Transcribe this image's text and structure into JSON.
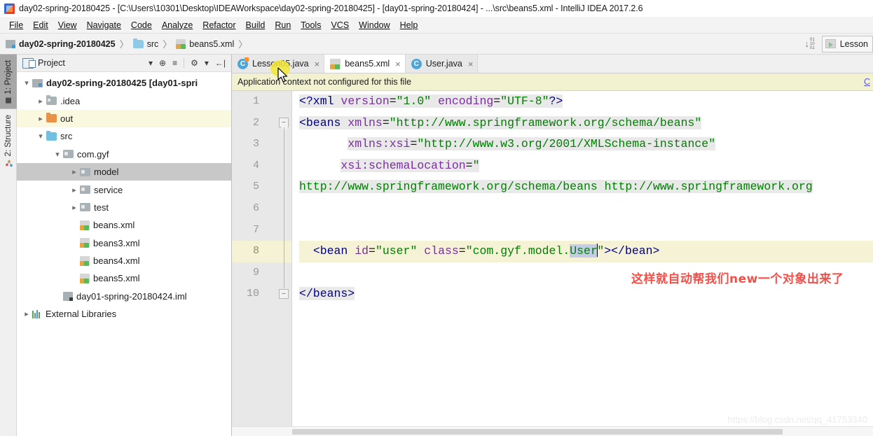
{
  "window": {
    "title": "day02-spring-20180425 - [C:\\Users\\10301\\Desktop\\IDEAWorkspace\\day02-spring-20180425] - [day01-spring-20180424] - ...\\src\\beans5.xml - IntelliJ IDEA 2017.2.6",
    "app_icon": "intellij-idea-icon"
  },
  "menubar": {
    "items": [
      {
        "label": "File"
      },
      {
        "label": "Edit"
      },
      {
        "label": "View"
      },
      {
        "label": "Navigate"
      },
      {
        "label": "Code"
      },
      {
        "label": "Analyze"
      },
      {
        "label": "Refactor"
      },
      {
        "label": "Build"
      },
      {
        "label": "Run"
      },
      {
        "label": "Tools"
      },
      {
        "label": "VCS"
      },
      {
        "label": "Window"
      },
      {
        "label": "Help"
      }
    ]
  },
  "navbar": {
    "crumbs": [
      {
        "label": "day02-spring-20180425",
        "icon": "module-icon",
        "bold": true
      },
      {
        "label": "src",
        "icon": "source-folder-icon",
        "bold": false
      },
      {
        "label": "beans5.xml",
        "icon": "xml-file-icon",
        "bold": false
      }
    ],
    "separator": "〉",
    "sort_icon": "sort-numeric-icon",
    "run_config": {
      "label": "Lesson",
      "icon": "run-config-icon"
    }
  },
  "toolstrip": {
    "tabs": [
      {
        "label": "1: Project",
        "icon": "project-tool-icon",
        "active": true
      },
      {
        "label": "2: Structure",
        "icon": "structure-tool-icon",
        "active": false
      }
    ]
  },
  "project_panel": {
    "title": "Project",
    "title_icon": "project-view-icon",
    "tools": [
      {
        "name": "view-options-dropdown",
        "glyph": "▾"
      },
      {
        "name": "scroll-from-source-icon",
        "glyph": "⊕"
      },
      {
        "name": "collapse-all-icon",
        "glyph": "≡"
      },
      {
        "name": "settings-gear-icon",
        "glyph": "⚙"
      },
      {
        "name": "gear-dropdown-icon",
        "glyph": "▾"
      },
      {
        "name": "hide-panel-icon",
        "glyph": "←|"
      }
    ],
    "tree": [
      {
        "label": "day02-spring-20180425 [day01-spri",
        "indent": 0,
        "arrow": "expanded",
        "icon": "module-icon",
        "bold": true,
        "state": "none"
      },
      {
        "label": ".idea",
        "indent": 1,
        "arrow": "collapsed",
        "icon": "folder-grey-icon",
        "bold": false,
        "state": "none"
      },
      {
        "label": "out",
        "indent": 1,
        "arrow": "collapsed",
        "icon": "folder-orange-icon",
        "bold": false,
        "state": "yellow"
      },
      {
        "label": "src",
        "indent": 1,
        "arrow": "expanded",
        "icon": "source-folder-icon",
        "bold": false,
        "state": "none"
      },
      {
        "label": "com.gyf",
        "indent": 2,
        "arrow": "expanded",
        "icon": "package-icon",
        "bold": false,
        "state": "none"
      },
      {
        "label": "model",
        "indent": 3,
        "arrow": "collapsed",
        "icon": "package-icon",
        "bold": false,
        "state": "grey"
      },
      {
        "label": "service",
        "indent": 3,
        "arrow": "collapsed",
        "icon": "package-icon",
        "bold": false,
        "state": "none"
      },
      {
        "label": "test",
        "indent": 3,
        "arrow": "collapsed",
        "icon": "package-icon",
        "bold": false,
        "state": "none"
      },
      {
        "label": "beans.xml",
        "indent": 3,
        "arrow": "none",
        "icon": "xml-file-icon",
        "bold": false,
        "state": "none"
      },
      {
        "label": "beans3.xml",
        "indent": 3,
        "arrow": "none",
        "icon": "xml-file-icon",
        "bold": false,
        "state": "none"
      },
      {
        "label": "beans4.xml",
        "indent": 3,
        "arrow": "none",
        "icon": "xml-file-icon",
        "bold": false,
        "state": "none"
      },
      {
        "label": "beans5.xml",
        "indent": 3,
        "arrow": "none",
        "icon": "xml-file-icon",
        "bold": false,
        "state": "none"
      },
      {
        "label": "day01-spring-20180424.iml",
        "indent": 2,
        "arrow": "none",
        "icon": "iml-file-icon",
        "bold": false,
        "state": "none"
      },
      {
        "label": "External Libraries",
        "indent": 0,
        "arrow": "collapsed",
        "icon": "library-icon",
        "bold": false,
        "state": "none"
      }
    ]
  },
  "editor": {
    "tabs": [
      {
        "label": "Lesson05.java",
        "icon": "java-class-icon",
        "active": false,
        "close": "×"
      },
      {
        "label": "beans5.xml",
        "icon": "xml-file-icon",
        "active": true,
        "close": "×"
      },
      {
        "label": "User.java",
        "icon": "java-class-icon",
        "active": false,
        "close": "×"
      }
    ],
    "notification": {
      "message": "Application context not configured for this file",
      "link": "C"
    },
    "line_numbers": [
      "1",
      "2",
      "3",
      "4",
      "5",
      "6",
      "7",
      "8",
      "9",
      "10"
    ],
    "current_line": 8,
    "annotation": "这样就自动帮我们new一个对象出来了",
    "watermark": "https://blog.csdn.net/qq_41753340",
    "code_lines": [
      {
        "n": 1,
        "segments": [
          {
            "t": "<?",
            "c": "tag",
            "bg": true
          },
          {
            "t": "xml",
            "c": "tag",
            "bg": true
          },
          {
            "t": " ",
            "c": "plain",
            "bg": true
          },
          {
            "t": "version",
            "c": "attr",
            "bg": true
          },
          {
            "t": "=",
            "c": "plain",
            "bg": true
          },
          {
            "t": "\"1.0\"",
            "c": "str",
            "bg": true
          },
          {
            "t": " ",
            "c": "plain",
            "bg": true
          },
          {
            "t": "encoding",
            "c": "attr",
            "bg": true
          },
          {
            "t": "=",
            "c": "plain",
            "bg": true
          },
          {
            "t": "\"UTF-8\"",
            "c": "str",
            "bg": true
          },
          {
            "t": "?>",
            "c": "tag",
            "bg": true
          }
        ]
      },
      {
        "n": 2,
        "segments": [
          {
            "t": "<beans",
            "c": "tag",
            "bg": true
          },
          {
            "t": " ",
            "c": "plain",
            "bg": true
          },
          {
            "t": "xmlns",
            "c": "attr",
            "bg": true
          },
          {
            "t": "=",
            "c": "plain",
            "bg": true
          },
          {
            "t": "\"http://www.springframework.org/schema/beans\"",
            "c": "str",
            "bg": true
          }
        ]
      },
      {
        "n": 3,
        "segments": [
          {
            "t": "       ",
            "c": "plain",
            "bg": false
          },
          {
            "t": "xmlns:xsi",
            "c": "attr",
            "bg": true
          },
          {
            "t": "=",
            "c": "plain",
            "bg": true
          },
          {
            "t": "\"http://www.w3.org/2001/XMLSchema-instance\"",
            "c": "str",
            "bg": true
          }
        ]
      },
      {
        "n": 4,
        "segments": [
          {
            "t": "      ",
            "c": "plain",
            "bg": false
          },
          {
            "t": "xsi:schemaLocation",
            "c": "attr",
            "bg": true
          },
          {
            "t": "=",
            "c": "plain",
            "bg": true
          },
          {
            "t": "\"",
            "c": "str",
            "bg": true
          }
        ]
      },
      {
        "n": 5,
        "segments": [
          {
            "t": "http://www.springframework.org/schema/beans http://www.springframework.org",
            "c": "str",
            "bg": true
          }
        ]
      },
      {
        "n": 6,
        "segments": []
      },
      {
        "n": 7,
        "segments": []
      },
      {
        "n": 8,
        "segments": [
          {
            "t": "  ",
            "c": "plain",
            "bg": false
          },
          {
            "t": "<bean",
            "c": "tag",
            "bg": false
          },
          {
            "t": " ",
            "c": "plain",
            "bg": false
          },
          {
            "t": "id",
            "c": "attr",
            "bg": false
          },
          {
            "t": "=",
            "c": "plain",
            "bg": false
          },
          {
            "t": "\"user\"",
            "c": "str",
            "bg": false
          },
          {
            "t": " ",
            "c": "plain",
            "bg": false
          },
          {
            "t": "class",
            "c": "attr",
            "bg": false
          },
          {
            "t": "=",
            "c": "plain",
            "bg": false
          },
          {
            "t": "\"com.gyf.model.",
            "c": "str",
            "bg": false
          },
          {
            "t": "User",
            "c": "str",
            "bg": false,
            "sel": true
          },
          {
            "t": "CARET",
            "c": "caret",
            "bg": false
          },
          {
            "t": "\"",
            "c": "str",
            "bg": false
          },
          {
            "t": "></bean>",
            "c": "tag",
            "bg": false
          }
        ]
      },
      {
        "n": 9,
        "segments": []
      },
      {
        "n": 10,
        "segments": [
          {
            "t": "</beans>",
            "c": "tag",
            "bg": true
          }
        ]
      }
    ]
  }
}
